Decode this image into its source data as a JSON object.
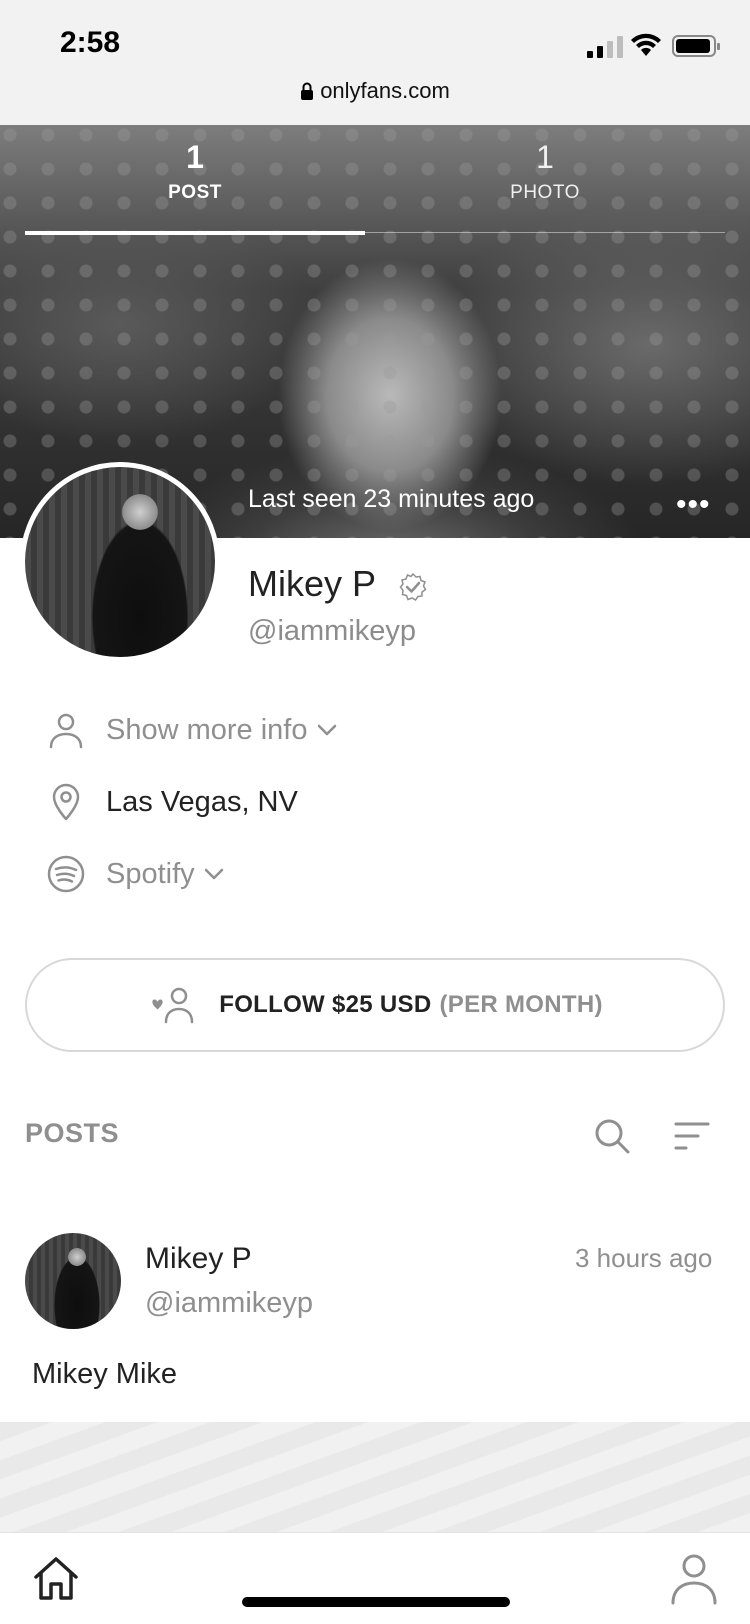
{
  "status_bar": {
    "time": "2:58",
    "url": "onlyfans.com",
    "icons": [
      "signal-icon",
      "wifi-icon",
      "battery-icon",
      "lock-icon"
    ]
  },
  "cover": {
    "tabs": [
      {
        "count": "1",
        "label": "POST"
      },
      {
        "count": "1",
        "label": "PHOTO"
      }
    ],
    "last_seen": "Last seen 23 minutes ago",
    "more_icon": "more-dots-icon"
  },
  "profile": {
    "name": "Mikey P",
    "handle": "@iammikeyp",
    "verified_icon": "verified-check-icon"
  },
  "info": {
    "show_more": "Show more info",
    "location": "Las Vegas, NV",
    "spotify": "Spotify"
  },
  "follow": {
    "main": "FOLLOW $25 USD",
    "per": "(PER MONTH)"
  },
  "posts_section": {
    "title": "POSTS"
  },
  "post": {
    "name": "Mikey P",
    "handle": "@iammikeyp",
    "time": "3 hours ago",
    "text": "Mikey Mike"
  },
  "bottom_nav": {
    "items": [
      "home-icon",
      "profile-icon"
    ]
  }
}
